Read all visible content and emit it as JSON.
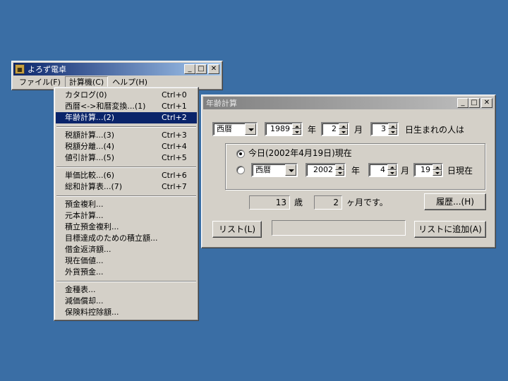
{
  "main_window": {
    "title": "よろず電卓",
    "menu": [
      "ファイル(F)",
      "計算機(C)",
      "ヘルプ(H)"
    ]
  },
  "dropdown": {
    "groups": [
      [
        {
          "label": "カタログ(0)",
          "shortcut": "Ctrl+0"
        },
        {
          "label": "西暦<->和暦変換...(1)",
          "shortcut": "Ctrl+1"
        },
        {
          "label": "年齢計算...(2)",
          "shortcut": "Ctrl+2",
          "highlighted": true
        }
      ],
      [
        {
          "label": "税額計算...(3)",
          "shortcut": "Ctrl+3"
        },
        {
          "label": "税額分離...(4)",
          "shortcut": "Ctrl+4"
        },
        {
          "label": "値引計算...(5)",
          "shortcut": "Ctrl+5"
        }
      ],
      [
        {
          "label": "単価比較...(6)",
          "shortcut": "Ctrl+6"
        },
        {
          "label": "総和計算表...(7)",
          "shortcut": "Ctrl+7"
        }
      ],
      [
        {
          "label": "預金複利...",
          "shortcut": ""
        },
        {
          "label": "元本計算...",
          "shortcut": ""
        },
        {
          "label": "積立預金複利...",
          "shortcut": ""
        },
        {
          "label": "目標達成のための積立額...",
          "shortcut": ""
        },
        {
          "label": "借金返済額...",
          "shortcut": ""
        },
        {
          "label": "現在価値...",
          "shortcut": ""
        },
        {
          "label": "外貨預金...",
          "shortcut": ""
        }
      ],
      [
        {
          "label": "金種表...",
          "shortcut": ""
        },
        {
          "label": "減価償却...",
          "shortcut": ""
        },
        {
          "label": "保険料控除額...",
          "shortcut": ""
        }
      ]
    ]
  },
  "dialog": {
    "title": "年齢計算",
    "birth": {
      "era": "西暦",
      "year": "1989",
      "year_label": "年",
      "month": "2",
      "month_label": "月",
      "day": "3",
      "day_label": "日生まれの人は"
    },
    "option_today": "今日(2002年4月19日)現在",
    "ref": {
      "era": "西暦",
      "year": "2002",
      "year_label": "年",
      "month": "4",
      "month_label": "月",
      "day": "19",
      "day_label": "日現在"
    },
    "result": {
      "years": "13",
      "years_label": "歳",
      "months": "2",
      "months_label": "ヶ月です。"
    },
    "history_button": "履歴...(H)",
    "list_button": "リスト(L)",
    "add_button": "リストに追加(A)"
  }
}
